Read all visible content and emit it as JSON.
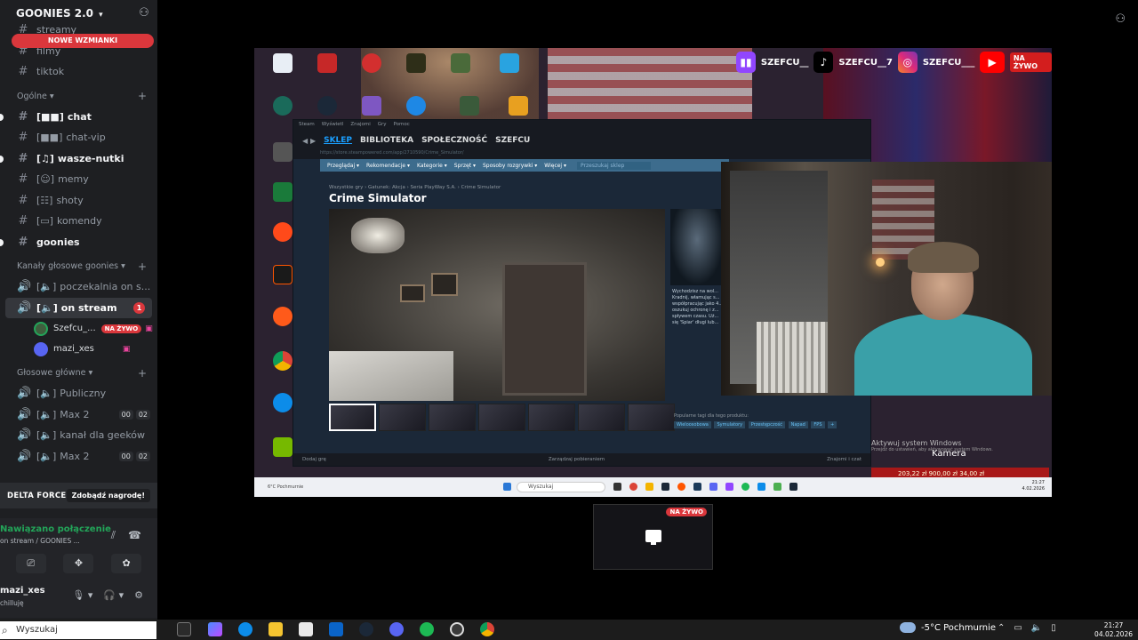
{
  "server": {
    "name": "GOONIES 2.0",
    "new_mentions": "NOWE WZMIANKI"
  },
  "channels_top": [
    {
      "label": "streamy"
    },
    {
      "label": "filmy"
    },
    {
      "label": "tiktok"
    }
  ],
  "categories": {
    "general": "Ogólne",
    "voice_goonies": "Kanały głosowe goonies",
    "voice_main": "Głosowe główne"
  },
  "general_channels": [
    {
      "label": "chat",
      "icon": "[■■]"
    },
    {
      "label": "chat-vip",
      "icon": "[■■]"
    },
    {
      "label": "wasze-nutki",
      "icon": "[♫]"
    },
    {
      "label": "memy",
      "icon": "[☺]"
    },
    {
      "label": "shoty",
      "icon": "[☷]"
    },
    {
      "label": "komendy",
      "icon": "[▭]"
    },
    {
      "label": "goonies",
      "icon": ""
    }
  ],
  "voice_goonies": [
    {
      "label": "poczekalnia on s..."
    },
    {
      "label": "on stream",
      "badge": "1"
    }
  ],
  "voice_users": [
    {
      "name": "Szefcu_...",
      "live": "NA ŻYWO"
    },
    {
      "name": "mazi_xes"
    }
  ],
  "voice_main": [
    {
      "label": "Publiczny"
    },
    {
      "label": "Max 2",
      "left": "00",
      "right": "02"
    },
    {
      "label": "kanał dla geeków"
    },
    {
      "label": "Max 2",
      "left": "00",
      "right": "02"
    }
  ],
  "promo": {
    "brand": "DELTA FORCE",
    "cta": "Zdobądź nagrodę!"
  },
  "voice_panel": {
    "status": "Nawiązano połączenie",
    "sub": "on stream / GOONIES ..."
  },
  "user": {
    "name": "mazi_xes",
    "status": "chilluję"
  },
  "stream": {
    "socials": [
      "SZEFCU__",
      "SZEFCU__7",
      "SZEFCU___"
    ],
    "live_badge": "NA ŻYWO",
    "steam_tabs": [
      "SKLEP",
      "BIBLIOTEKA",
      "SPOŁECZNOŚĆ",
      "SZEFCU"
    ],
    "steam_top": [
      "Steam",
      "Wyświetl",
      "Znajomi",
      "Gry",
      "Pomoc"
    ],
    "steam_url": "https://store.steampowered.com/app/2710590/Crime_Simulator/",
    "steam_menu": [
      "Przeglądaj ▾",
      "Rekomendacje ▾",
      "Kategorie ▾",
      "Sprzęt ▾",
      "Sposoby rozgrywki ▾",
      "Więcej ▾"
    ],
    "steam_search": "Przeszukaj sklep",
    "breadcrumb": "Wszystkie gry › Gatunek: Akcja › Seria PlayWay S.A. › Crime Simulator",
    "game_title": "Crime Simulator",
    "desc": "Wychodzisz na wol... Kradnij, włamując s... współpracując jako 4... oszukuj ochronę i z... spływem czasu. Uż... się 'Spiar' długi lub...",
    "tags": [
      "Wieloosobowa",
      "Symulatory",
      "Przestępczość",
      "Napad",
      "FPS",
      "+"
    ],
    "tags_label": "Popularne tagi dla tego produktu:",
    "bottom_left": "Dodaj grę",
    "bottom_mid": "Zarządzaj pobieraniem",
    "bottom_right": "Znajomi i czat",
    "activate": "Aktywuj system Windows",
    "activate_sub": "Przejdź do ustawień, aby aktywować system Windows.",
    "kamera": "Kamera",
    "money": "203,22 zł   900,00 zł   34,00 zł",
    "inner_search": "Wyszukaj",
    "inner_weather": "6°C Pochmurnie",
    "inner_time": "21:27",
    "inner_date": "4.02.2026"
  },
  "preview": {
    "live": "NA ŻYWO"
  },
  "taskbar": {
    "search": "Wyszukaj",
    "weather": "-5°C  Pochmurnie",
    "time": "21:27",
    "date": "04.02.2026"
  }
}
